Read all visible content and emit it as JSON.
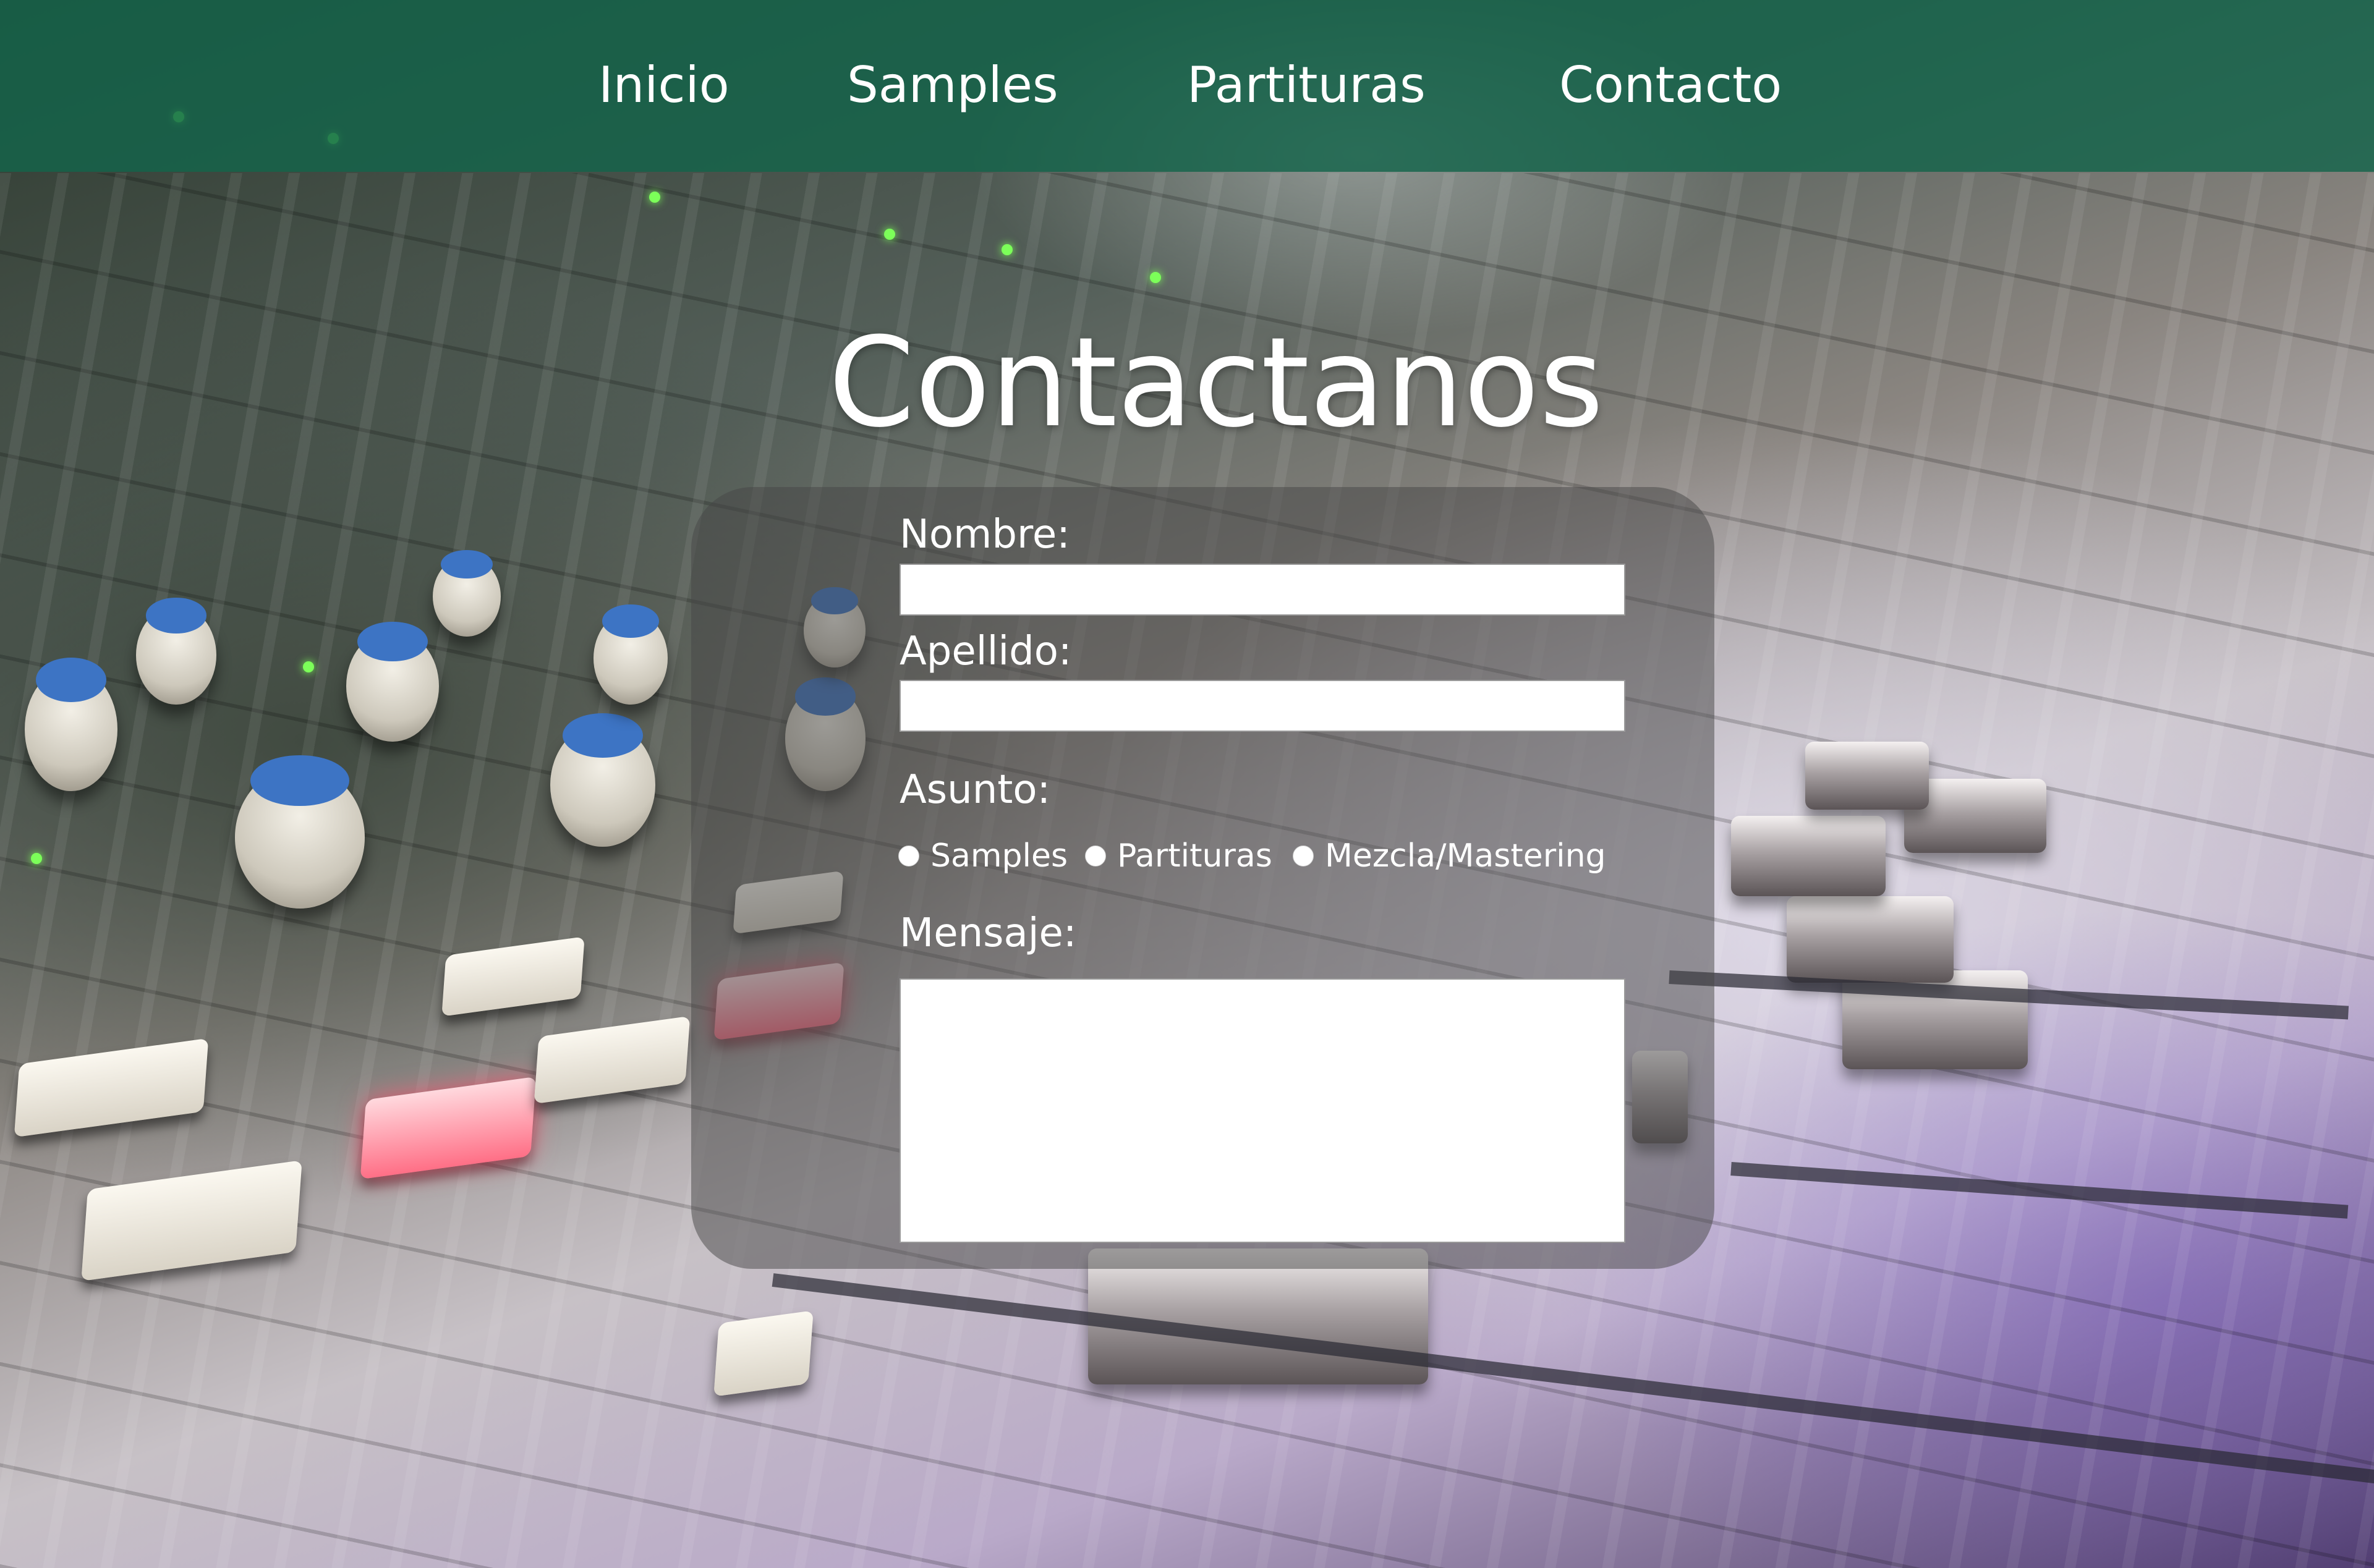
{
  "nav": {
    "items": [
      {
        "label": "Inicio"
      },
      {
        "label": "Samples"
      },
      {
        "label": "Partituras"
      },
      {
        "label": "Contacto"
      }
    ]
  },
  "main": {
    "title": "Contactanos"
  },
  "form": {
    "nombre": {
      "label": "Nombre:",
      "value": ""
    },
    "apellido": {
      "label": "Apellido:",
      "value": ""
    },
    "asunto": {
      "label": "Asunto:",
      "options": [
        {
          "label": "Samples"
        },
        {
          "label": "Partituras"
        },
        {
          "label": "Mezcla/Mastering"
        }
      ]
    },
    "mensaje": {
      "label": "Mensaje:",
      "value": ""
    }
  },
  "colors": {
    "nav_bg": "#14644B",
    "panel_bg": "#464646",
    "text": "#FFFFFF",
    "field_bg": "#FFFFFF"
  }
}
